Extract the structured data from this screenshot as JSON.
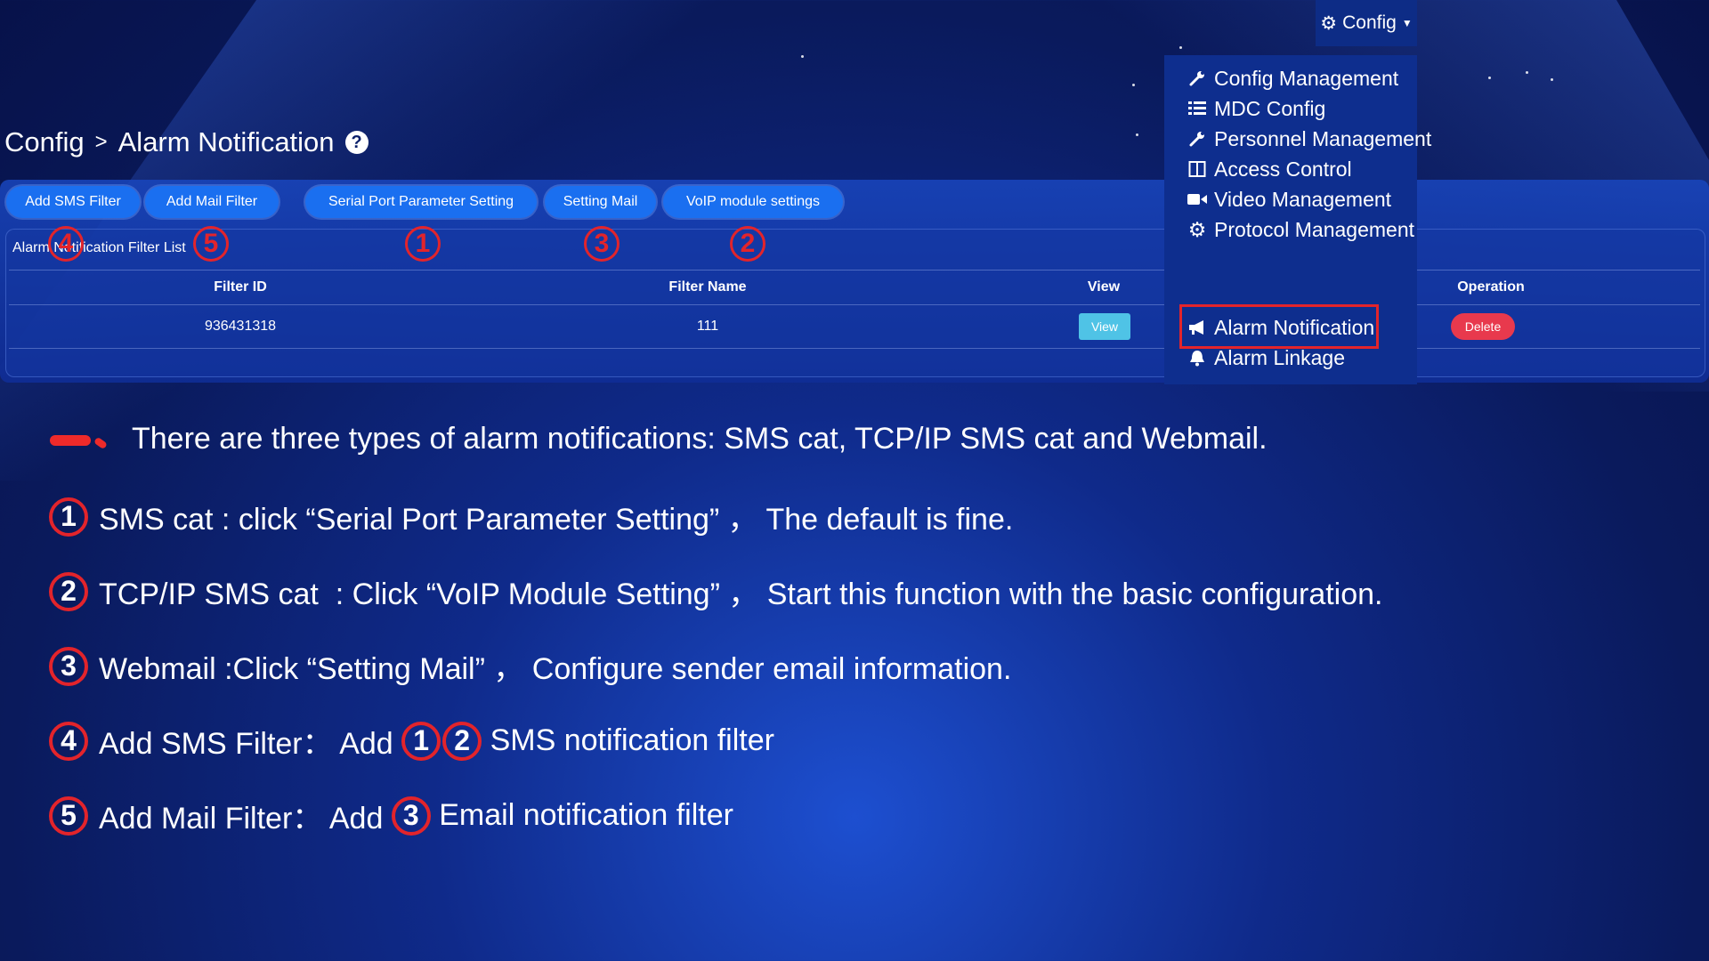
{
  "config_menu": {
    "label": "Config"
  },
  "breadcrumb": {
    "root": "Config",
    "separator": ">",
    "current": "Alarm Notification"
  },
  "toolbar": {
    "buttons": [
      "Add SMS Filter",
      "Add Mail Filter",
      "Serial Port Parameter Setting",
      "Setting Mail",
      "VoIP module settings"
    ]
  },
  "list": {
    "title": "Alarm Notification Filter List",
    "columns": [
      "Filter ID",
      "Filter Name",
      "View",
      "Operation"
    ],
    "rows": [
      {
        "filter_id": "936431318",
        "filter_name": "111",
        "view": "View",
        "operation": "Delete"
      }
    ]
  },
  "dropdown": {
    "items": [
      {
        "label": "Config Management",
        "icon": "wrench-icon"
      },
      {
        "label": "MDC Config",
        "icon": "list-icon"
      },
      {
        "label": "Personnel Management",
        "icon": "wrench-icon"
      },
      {
        "label": "Access Control",
        "icon": "door-icon"
      },
      {
        "label": "Video Management",
        "icon": "video-camera-icon"
      },
      {
        "label": "Protocol Management",
        "icon": "gears-icon"
      },
      {
        "label": "Alarm Notification",
        "icon": "bullhorn-icon"
      },
      {
        "label": "Alarm Linkage",
        "icon": "bell-icon"
      }
    ]
  },
  "callout_numbers": [
    "4",
    "5",
    "1",
    "3",
    "2"
  ],
  "instructions": [
    "There are three types of alarm notifications: SMS cat, TCP/IP SMS cat and Webmail.",
    "SMS cat : click “Serial Port Parameter Setting” ， The default is fine.",
    "TCP/IP SMS cat  : Click “VoIP Module Setting” ， Start this function with the basic configuration.",
    "Webmail :Click “Setting Mail” ， Configure sender email information.",
    "Add SMS Filter： Add ",
    " SMS notification filter",
    "Add Mail Filter： Add ",
    " Email notification filter"
  ],
  "colors": {
    "accent": "#1a6ff0",
    "highlight": "#e3242b",
    "delete": "#e8394d",
    "view": "#4fc3e6"
  }
}
